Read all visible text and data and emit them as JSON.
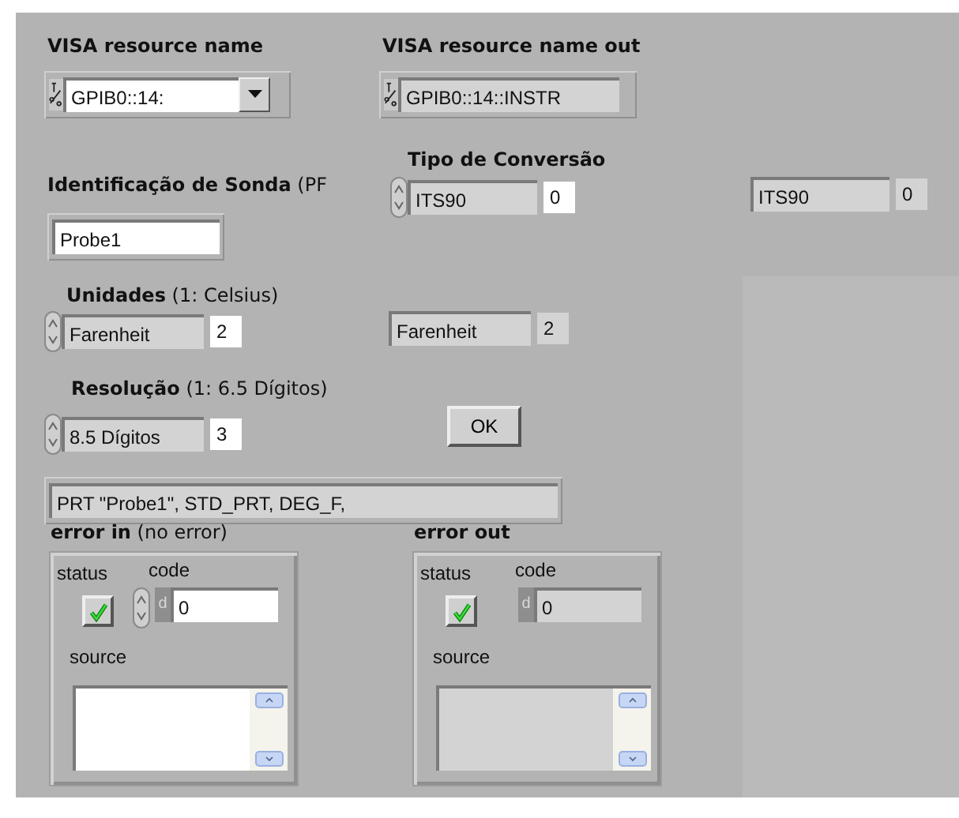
{
  "visa_in": {
    "label": "VISA resource name",
    "value": "GPIB0::14:"
  },
  "visa_out": {
    "label": "VISA resource name out",
    "value": "GPIB0::14::INSTR"
  },
  "probe_id": {
    "label": "**Identificação de Sonda** (PF",
    "value": "Probe1"
  },
  "conversion": {
    "label": "Tipo de Conversão",
    "value": "ITS90",
    "index": "0"
  },
  "conversion_out": {
    "value": "ITS90",
    "index": "0"
  },
  "units": {
    "label": "**Unidades** (1: Celsius)",
    "value": "Farenheit",
    "index": "2"
  },
  "units_out": {
    "value": "Farenheit",
    "index": "2"
  },
  "resolution": {
    "label": "**Resolução** (1: 6.5 Dígitos)",
    "value": "8.5 Dígitos",
    "index": "3"
  },
  "ok_button": "OK",
  "command_string": "PRT \"Probe1\", STD_PRT, DEG_F,",
  "error_clusters": [
    {
      "kind": "control",
      "label": "**error in** (no error)",
      "status_label": "status",
      "status_checked": true,
      "code_label": "code",
      "radix": "d",
      "code": "0",
      "source_label": "source"
    },
    {
      "kind": "indicator",
      "label": "error out",
      "status_label": "status",
      "status_checked": true,
      "code_label": "code",
      "radix": "d",
      "code": "0",
      "source_label": "source"
    }
  ]
}
